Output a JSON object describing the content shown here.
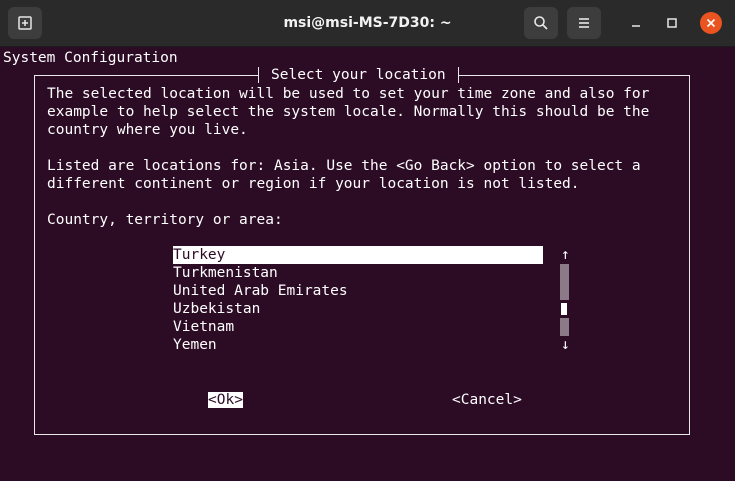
{
  "window": {
    "title": "msi@msi-MS-7D30: ~"
  },
  "terminal": {
    "header": "System Configuration",
    "dialog": {
      "title": "Select your location",
      "paragraph1": [
        "The selected location will be used to set your time zone and also for",
        "example to help select the system locale. Normally this should be the",
        "country where you live."
      ],
      "paragraph2": [
        "Listed are locations for: Asia. Use the <Go Back> option to select a",
        "different continent or region if your location is not listed."
      ],
      "prompt": "Country, territory or area:",
      "options": [
        {
          "label": "Turkey",
          "selected": true
        },
        {
          "label": "Turkmenistan",
          "selected": false
        },
        {
          "label": "United Arab Emirates",
          "selected": false
        },
        {
          "label": "Uzbekistan",
          "selected": false
        },
        {
          "label": "Vietnam",
          "selected": false
        },
        {
          "label": "Yemen",
          "selected": false
        }
      ],
      "scroll_up": "↑",
      "scroll_down": "↓",
      "ok_open": "<",
      "ok_hotkey": "O",
      "ok_rest": "k>",
      "cancel_label": "<Cancel>"
    }
  },
  "colors": {
    "terminal_background": "#2c0b24",
    "titlebar": "#2a2a2a",
    "close_button": "#e95420",
    "text": "#ffffff"
  },
  "icons": {
    "new_tab": "new-tab-icon",
    "search": "search-icon",
    "menu": "hamburger-menu-icon",
    "minimize": "minimize-icon",
    "maximize": "maximize-icon",
    "close": "close-icon"
  }
}
